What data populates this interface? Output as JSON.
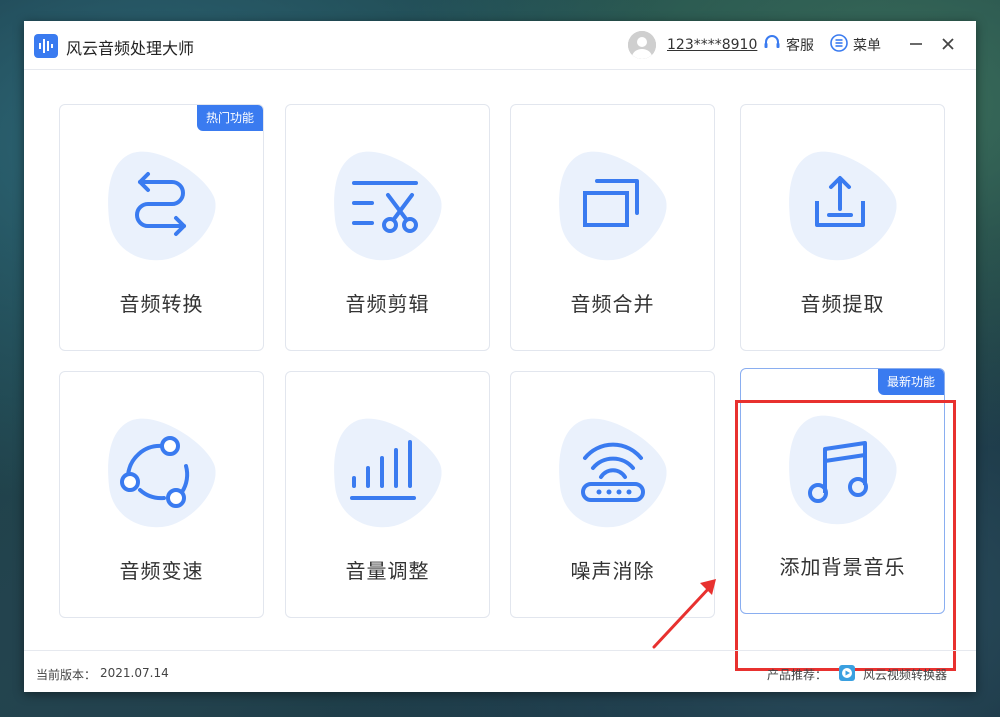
{
  "app": {
    "title": "风云音频处理大师"
  },
  "header": {
    "user_phone": "123****8910",
    "service_label": "客服",
    "menu_label": "菜单"
  },
  "features": [
    {
      "label": "音频转换",
      "icon": "convert-arrows-icon",
      "tag": "热门功能"
    },
    {
      "label": "音频剪辑",
      "icon": "scissors-icon"
    },
    {
      "label": "音频合并",
      "icon": "merge-windows-icon"
    },
    {
      "label": "音频提取",
      "icon": "export-tray-icon"
    },
    {
      "label": "音频变速",
      "icon": "speed-circle-icon"
    },
    {
      "label": "音量调整",
      "icon": "volume-bars-icon"
    },
    {
      "label": "噪声消除",
      "icon": "router-wifi-icon"
    },
    {
      "label": "添加背景音乐",
      "icon": "music-note-icon",
      "tag": "最新功能"
    }
  ],
  "footer": {
    "version_label": "当前版本：",
    "version_value": "2021.07.14",
    "recommend_label": "产品推荐：",
    "recommend_app": "风云视频转换器"
  },
  "colors": {
    "accent": "#3a7bf0",
    "icon_blob": "#eaf1fc",
    "highlight_border": "#e8312f"
  }
}
